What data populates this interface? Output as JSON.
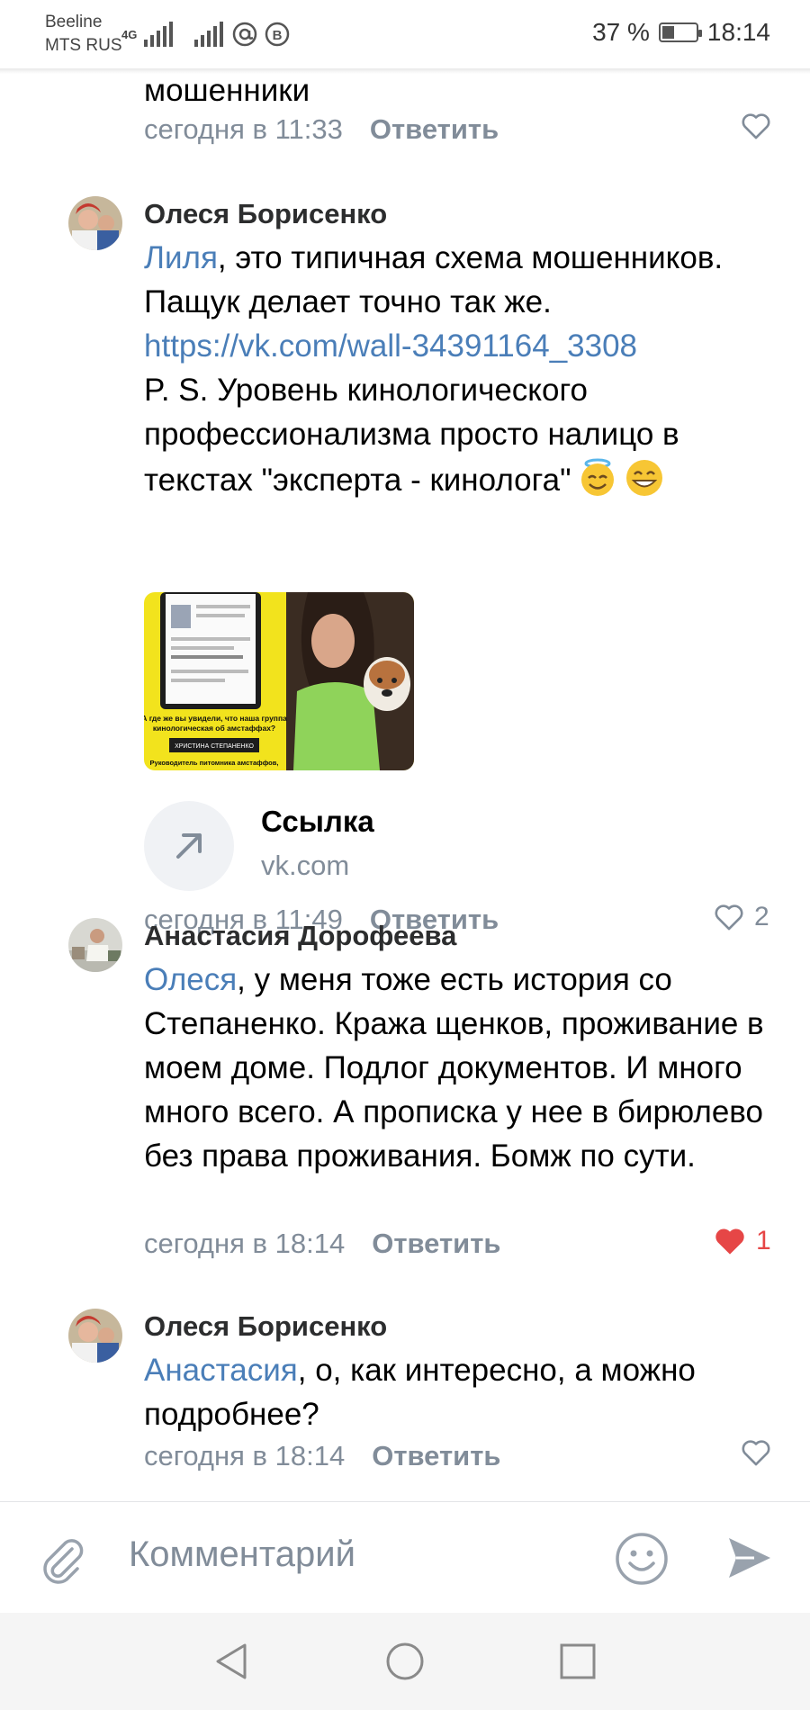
{
  "status": {
    "carrier_line1": "Beeline",
    "carrier_line2": "MTS RUS",
    "network": "4G",
    "battery": "37 %",
    "battery_level": 0.37,
    "time": "18:14"
  },
  "comments": [
    {
      "text_tail": "мошенники",
      "time": "сегодня в 11:33",
      "reply_label": "Ответить",
      "likes": "",
      "liked": false
    },
    {
      "author": "Олеся Борисенко",
      "mention": "Лиля",
      "text_a": ", это типичная схема мошенников. Пащук делает точно так же. ",
      "link": "https://vk.com/wall-34391164_3308",
      "text_b": "P. S. Уровень кинологического профессионализма просто налицо в текстах \"эксперта - кинолога\"",
      "emojis": [
        "smiling-face-with-halo",
        "grinning-face"
      ],
      "photo": {
        "caption_line1": "А где же вы увидели, что наша группа",
        "caption_line2": "кинологическая об амстаффах?",
        "name_badge": "ХРИСТИНА СТЕПАНЕНКО",
        "footer": "Руководитель питомника амстаффов,"
      },
      "link_card": {
        "title": "Ссылка",
        "domain": "vk.com"
      },
      "time": "сегодня в 11:49",
      "reply_label": "Ответить",
      "likes": "2",
      "liked": false
    },
    {
      "author": "Анастасия Дорофеева",
      "mention": "Олеся",
      "text": ", у меня тоже есть история со Степаненко. Кража щенков, проживание в моем доме. Подлог документов. И много много всего. А прописка у нее в бирюлево без права проживания. Бомж по сути.",
      "time": "сегодня в 18:14",
      "reply_label": "Ответить",
      "likes": "1",
      "liked": true
    },
    {
      "author": "Олеся Борисенко",
      "mention": "Анастасия",
      "text": ", о, как интересно, а можно подробнее?",
      "time": "сегодня в 18:14",
      "reply_label": "Ответить",
      "likes": "",
      "liked": false
    }
  ],
  "composer": {
    "placeholder": "Комментарий",
    "attach_icon": "paperclip-icon",
    "emoji_icon": "smiley-icon",
    "send_icon": "send-icon"
  },
  "navbar": {
    "back_icon": "back-triangle-icon",
    "home_icon": "home-circle-icon",
    "recents_icon": "recents-square-icon"
  },
  "colors": {
    "link": "#4a7eb8",
    "meta": "#818c99",
    "liked": "#e64646",
    "author": "#2c2d2e"
  }
}
